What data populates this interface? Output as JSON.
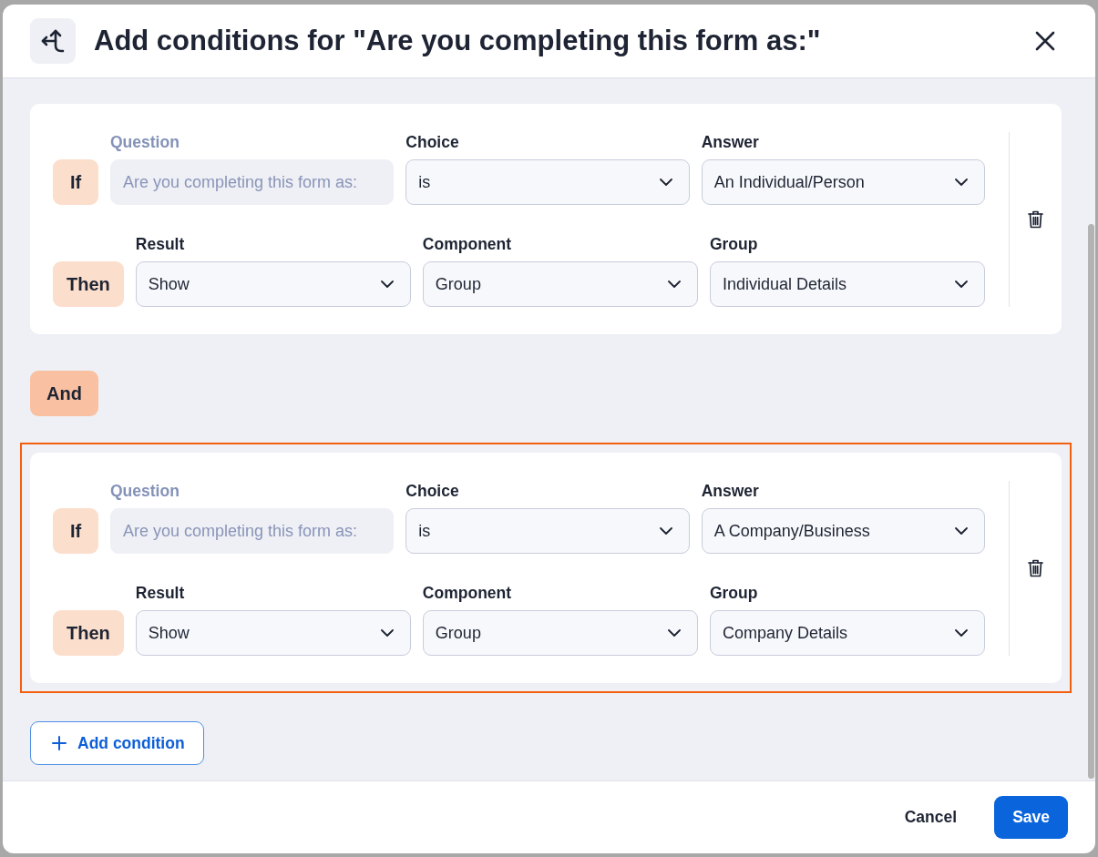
{
  "dialog": {
    "title": "Add conditions for \"Are you completing this form as:\""
  },
  "blocks": [
    {
      "kind": "condition",
      "selected": false,
      "rows": [
        {
          "keyword": "If",
          "fields": [
            {
              "kind": "text",
              "label": "Question",
              "value": "Are you completing this form as:",
              "disabled": true
            },
            {
              "kind": "select",
              "label": "Choice",
              "value": "is",
              "disabled": false
            },
            {
              "kind": "select",
              "label": "Answer",
              "value": "An Individual/Person",
              "disabled": false
            }
          ]
        },
        {
          "keyword": "Then",
          "fields": [
            {
              "kind": "select",
              "label": "Result",
              "value": "Show",
              "disabled": false
            },
            {
              "kind": "select",
              "label": "Component",
              "value": "Group",
              "disabled": false
            },
            {
              "kind": "select",
              "label": "Group",
              "value": "Individual Details",
              "disabled": false
            }
          ]
        }
      ]
    },
    {
      "kind": "operator",
      "label": "And"
    },
    {
      "kind": "condition",
      "selected": true,
      "rows": [
        {
          "keyword": "If",
          "fields": [
            {
              "kind": "text",
              "label": "Question",
              "value": "Are you completing this form as:",
              "disabled": true
            },
            {
              "kind": "select",
              "label": "Choice",
              "value": "is",
              "disabled": false
            },
            {
              "kind": "select",
              "label": "Answer",
              "value": "A Company/Business",
              "disabled": false
            }
          ]
        },
        {
          "keyword": "Then",
          "fields": [
            {
              "kind": "select",
              "label": "Result",
              "value": "Show",
              "disabled": false
            },
            {
              "kind": "select",
              "label": "Component",
              "value": "Group",
              "disabled": false
            },
            {
              "kind": "select",
              "label": "Group",
              "value": "Company Details",
              "disabled": false
            }
          ]
        }
      ]
    }
  ],
  "add_button": {
    "label": "Add condition"
  },
  "footer": {
    "buttons": [
      {
        "kind": "secondary",
        "label": "Cancel"
      },
      {
        "kind": "primary",
        "label": "Save"
      }
    ]
  }
}
